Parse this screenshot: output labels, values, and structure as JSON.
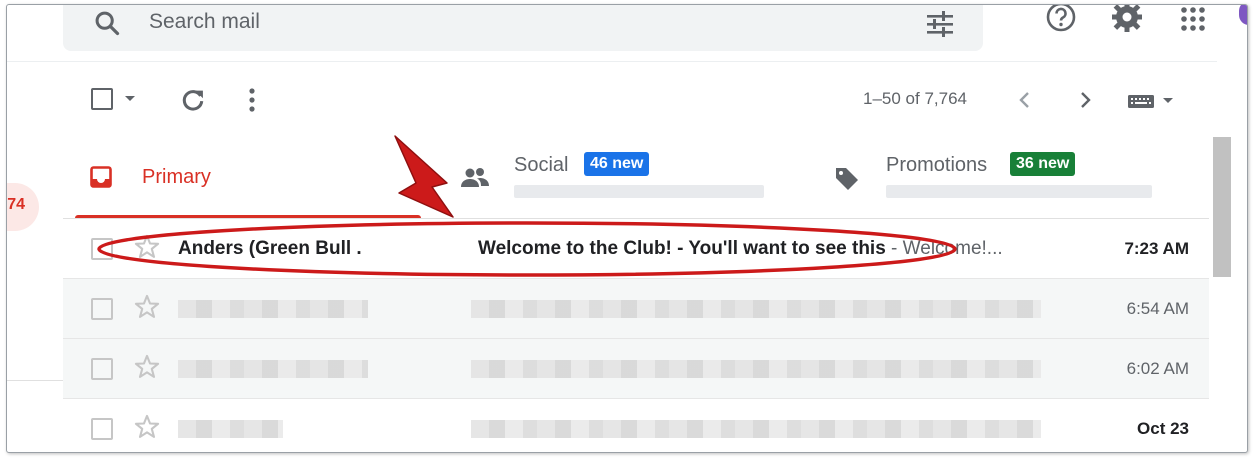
{
  "search": {
    "placeholder": "Search mail"
  },
  "gutter": {
    "count_partial": "74"
  },
  "toolbar": {
    "pagination": "1–50 of 7,764"
  },
  "tabs": [
    {
      "label": "Primary",
      "color": "#d93025"
    },
    {
      "label": "Social",
      "badge": "46 new",
      "badge_color": "#1a73e8"
    },
    {
      "label": "Promotions",
      "badge": "36 new",
      "badge_color": "#188038"
    }
  ],
  "emails": [
    {
      "sender": "Anders (Green Bull .",
      "subject": "Welcome to the Club! - You'll want to see this",
      "snippet": " - Welcome!...",
      "time": "7:23 AM",
      "unread": true
    },
    {
      "time": "6:54 AM",
      "unread": false
    },
    {
      "time": "6:02 AM",
      "unread": false
    },
    {
      "time": "Oct 23",
      "unread": true
    }
  ],
  "annotation_color": "#cc1a1a"
}
